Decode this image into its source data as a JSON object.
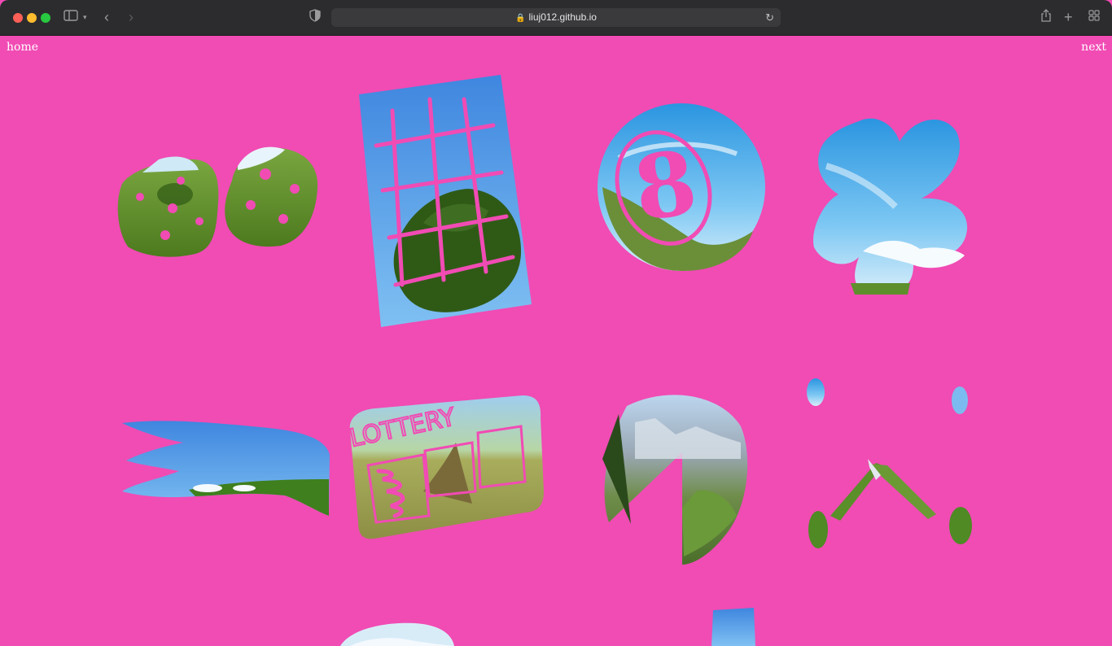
{
  "browser": {
    "url": "liuj012.github.io",
    "icons": {
      "sidebar": "sidebar-icon",
      "back": "chevron-left-icon",
      "forward": "chevron-right-icon",
      "shield": "shield-icon",
      "lock": "lock-icon",
      "reload": "reload-icon",
      "share": "share-icon",
      "new_tab": "plus-icon",
      "tabs": "tab-overview-icon"
    }
  },
  "nav": {
    "home_label": "home",
    "next_label": "next"
  },
  "colors": {
    "background": "#f14bb4",
    "sky": "#4f9de8",
    "grass": "#5e8f2c"
  },
  "cards": {
    "lottery_text": "LOTTERY",
    "eight_text": "8"
  }
}
